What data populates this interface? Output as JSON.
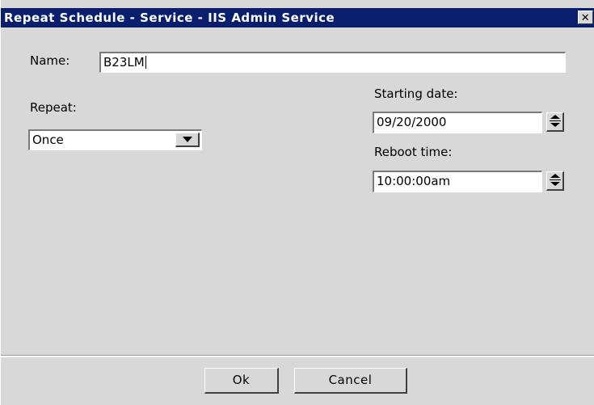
{
  "window": {
    "title": "Repeat Schedule - Service - IIS Admin Service",
    "close_glyph": "✕"
  },
  "form": {
    "name_label": "Name:",
    "name_value": "B23LM",
    "repeat_label": "Repeat:",
    "repeat_value": "Once",
    "starting_date_label": "Starting date:",
    "starting_date_value": "09/20/2000",
    "reboot_time_label": "Reboot time:",
    "reboot_time_value": "10:00:00am"
  },
  "buttons": {
    "ok_label": "Ok",
    "cancel_label": "Cancel"
  },
  "icons": {
    "dropdown": "chevron-down-icon",
    "spinner": "spinner-icon",
    "close": "close-icon"
  },
  "colors": {
    "titlebar": "#0a1e6e",
    "dialog_bg": "#d8d8d8",
    "field_bg": "#ffffff"
  }
}
